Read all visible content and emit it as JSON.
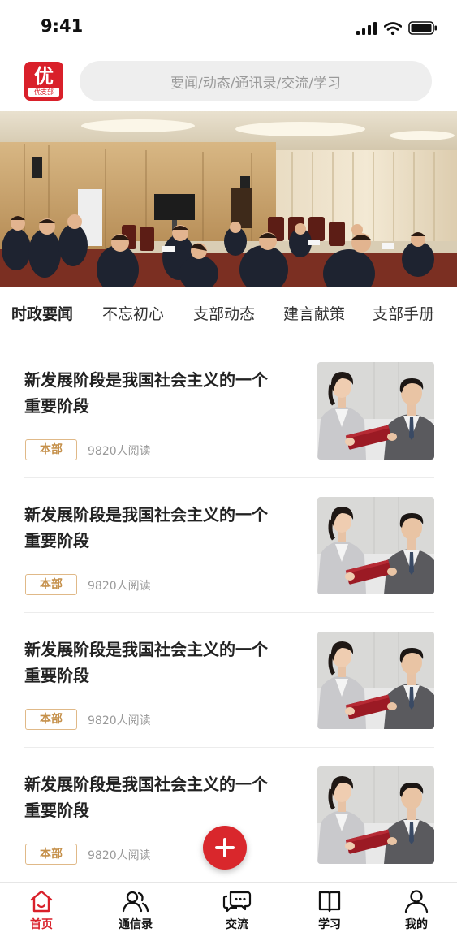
{
  "status_bar": {
    "time": "9:41",
    "icons": [
      "signal-icon",
      "wifi-icon",
      "battery-icon"
    ]
  },
  "header": {
    "logo_main": "优",
    "logo_sub": "优支部",
    "search_placeholder": "要闻/动态/通讯录/交流/学习"
  },
  "tabs": [
    {
      "label": "时政要闻",
      "active": true
    },
    {
      "label": "不忘初心",
      "active": false
    },
    {
      "label": "支部动态",
      "active": false
    },
    {
      "label": "建言献策",
      "active": false
    },
    {
      "label": "支部手册",
      "active": false
    }
  ],
  "news": [
    {
      "title": "新发展阶段是我国社会主义的一个重要阶段",
      "tag": "本部",
      "reads": "9820人阅读"
    },
    {
      "title": "新发展阶段是我国社会主义的一个重要阶段",
      "tag": "本部",
      "reads": "9820人阅读"
    },
    {
      "title": "新发展阶段是我国社会主义的一个重要阶段",
      "tag": "本部",
      "reads": "9820人阅读"
    },
    {
      "title": "新发展阶段是我国社会主义的一个重要阶段",
      "tag": "本部",
      "reads": "9820人阅读"
    }
  ],
  "bottom_nav": [
    {
      "label": "首页",
      "icon": "home-icon",
      "active": true
    },
    {
      "label": "通信录",
      "icon": "contacts-icon",
      "active": false
    },
    {
      "label": "交流",
      "icon": "chat-icon",
      "active": false
    },
    {
      "label": "学习",
      "icon": "book-icon",
      "active": false
    },
    {
      "label": "我的",
      "icon": "profile-icon",
      "active": false
    }
  ],
  "colors": {
    "accent": "#d9202a",
    "tag_text": "#c5904a",
    "tag_border": "#e0b988",
    "search_bg": "#eeeeee"
  }
}
